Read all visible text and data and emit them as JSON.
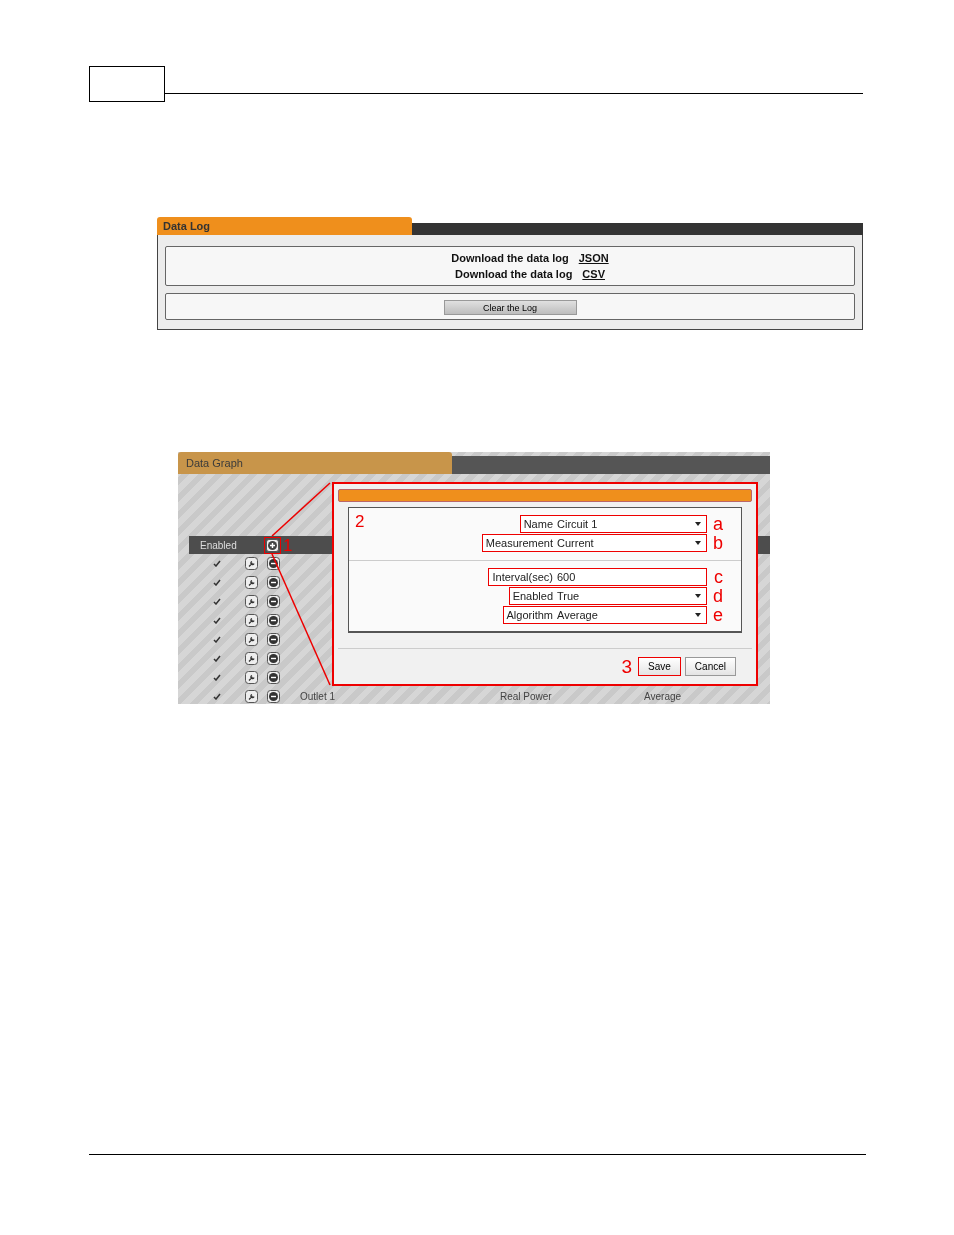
{
  "data_log": {
    "title": "Data Log",
    "downloads": [
      {
        "label": "Download the data log",
        "link": "JSON"
      },
      {
        "label": "Download the data log",
        "link": "CSV"
      }
    ],
    "clear_button": "Clear the Log"
  },
  "data_graph": {
    "title": "Data Graph",
    "table": {
      "header": "Enabled",
      "add_callout": "1",
      "rows": [
        {
          "enabled": true
        },
        {
          "enabled": true
        },
        {
          "enabled": true
        },
        {
          "enabled": true
        },
        {
          "enabled": true
        },
        {
          "enabled": true
        },
        {
          "enabled": true
        },
        {
          "enabled": true,
          "cells": [
            "Outlet 1",
            "Real Power",
            "Average"
          ]
        }
      ]
    },
    "dialog": {
      "callout": "2",
      "sections": [
        [
          {
            "kind": "select",
            "label": "Name",
            "value": "Circuit 1",
            "callout": "a"
          },
          {
            "kind": "select",
            "label": "Measurement",
            "value": "Current",
            "callout": "b"
          }
        ],
        [
          {
            "kind": "text",
            "label": "Interval(sec)",
            "value": "600",
            "callout": "c"
          },
          {
            "kind": "select",
            "label": "Enabled",
            "value": "True",
            "callout": "d"
          },
          {
            "kind": "select",
            "label": "Algorithm",
            "value": "Average",
            "callout": "e"
          }
        ]
      ],
      "buttons": [
        {
          "label": "Save",
          "callout": "3"
        },
        {
          "label": "Cancel"
        }
      ]
    }
  }
}
